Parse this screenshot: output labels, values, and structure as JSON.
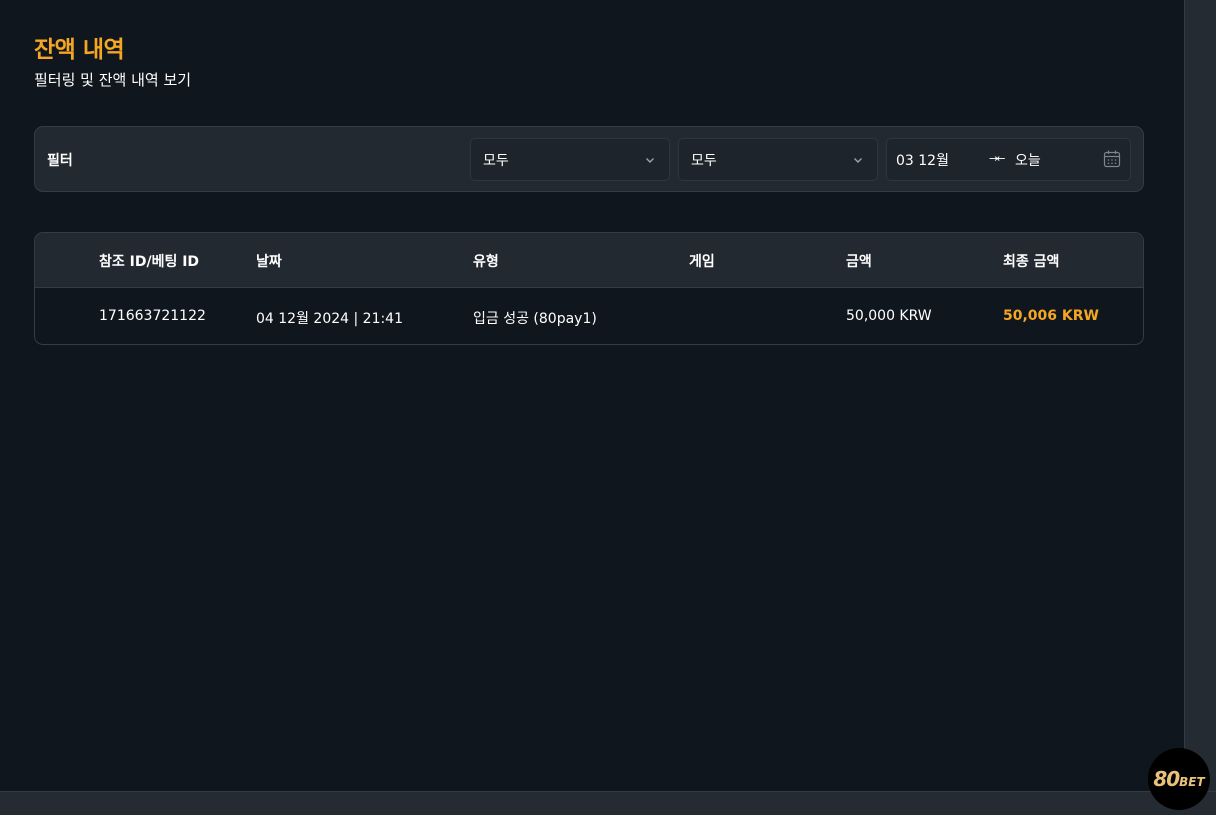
{
  "header": {
    "title": "잔액 내역",
    "subtitle": "필터링 및 잔액 내역 보기"
  },
  "filter": {
    "label": "필터",
    "select1_value": "모두",
    "select2_value": "모두",
    "date_start": "03 12월",
    "date_end": "오늘"
  },
  "table": {
    "headers": [
      "참조 ID/베팅 ID",
      "날짜",
      "유형",
      "게임",
      "금액",
      "최종 금액"
    ],
    "rows": [
      {
        "ref_id": "171663721122",
        "date": "04 12월 2024 | 21:41",
        "type": "입금 성공 (80pay1)",
        "game": "",
        "amount": "50,000 KRW",
        "final_amount": "50,006 KRW"
      }
    ]
  },
  "logo": {
    "num": "80",
    "word": "BET"
  },
  "colors": {
    "accent": "#f5a623",
    "background": "#0f161d",
    "panel": "#232930"
  }
}
